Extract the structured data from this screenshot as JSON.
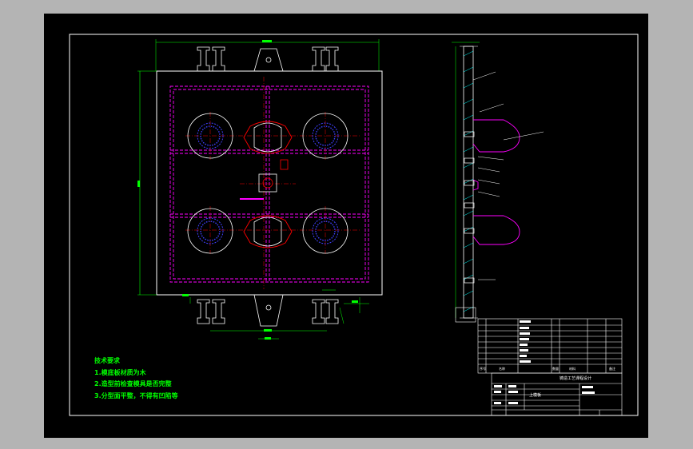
{
  "colors": {
    "sheet": "#000000",
    "outline": "#ffffff",
    "dimension": "#00ff00",
    "hidden": "#ff00ff",
    "center": "#ff0000",
    "hole": "#4040ff",
    "border": "#ffffff"
  },
  "notes": {
    "title": "技术要求",
    "items": [
      "1.模底板材质为木",
      "2.造型前检查模具是否完整",
      "3.分型面平整，不得有凹陷等"
    ]
  },
  "title_block": {
    "drawing_name": "上模板",
    "course_title": "铸造工艺课程设计",
    "header_no": "序号",
    "header_name": "名称",
    "header_qty": "数量",
    "header_material": "材料",
    "header_note": "备注"
  }
}
